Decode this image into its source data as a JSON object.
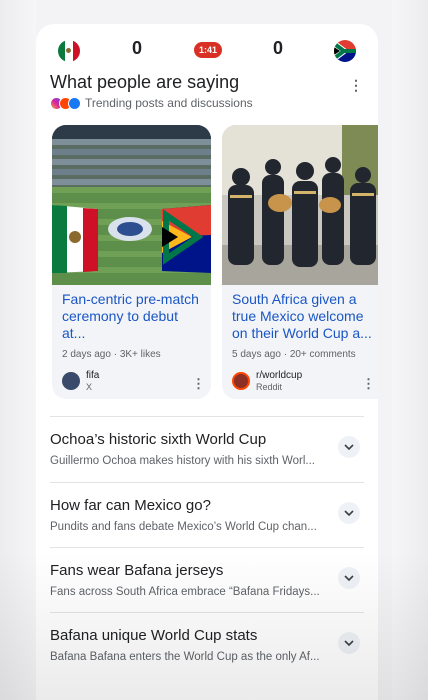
{
  "scoreboard": {
    "home_score": "0",
    "away_score": "0",
    "clock": "1:41",
    "home_flag_icon": "mexico-flag-icon",
    "away_flag_icon": "south-africa-flag-icon",
    "live_color": "#d93025"
  },
  "section": {
    "title": "What people are saying",
    "subtitle": "Trending posts and discussions",
    "source_icons": [
      "instagram-icon",
      "reddit-icon",
      "facebook-icon"
    ]
  },
  "posts": [
    {
      "title": "Fan-centric pre-match ceremony to debut at...",
      "meta": "2 days ago · 3K+ likes",
      "author": "fifa",
      "platform": "X",
      "image": "stadium-flags-image"
    },
    {
      "title": "South Africa given a true Mexico welcome on their World Cup a...",
      "meta": "5 days ago · 20+ comments",
      "author": "r/worldcup",
      "platform": "Reddit",
      "image": "mariachi-band-image"
    }
  ],
  "topics": [
    {
      "title": "Ochoa’s historic sixth World Cup",
      "desc": "Guillermo Ochoa makes history with his sixth Worl..."
    },
    {
      "title": "How far can Mexico go?",
      "desc": "Pundits and fans debate Mexico’s World Cup chan..."
    },
    {
      "title": "Fans wear Bafana jerseys",
      "desc": "Fans across South Africa embrace “Bafana Fridays..."
    },
    {
      "title": "Bafana unique World Cup stats",
      "desc": "Bafana Bafana enters the World Cup as the only Af..."
    }
  ],
  "colors": {
    "link": "#1a56c4",
    "card_bg": "#f2f4f8"
  }
}
